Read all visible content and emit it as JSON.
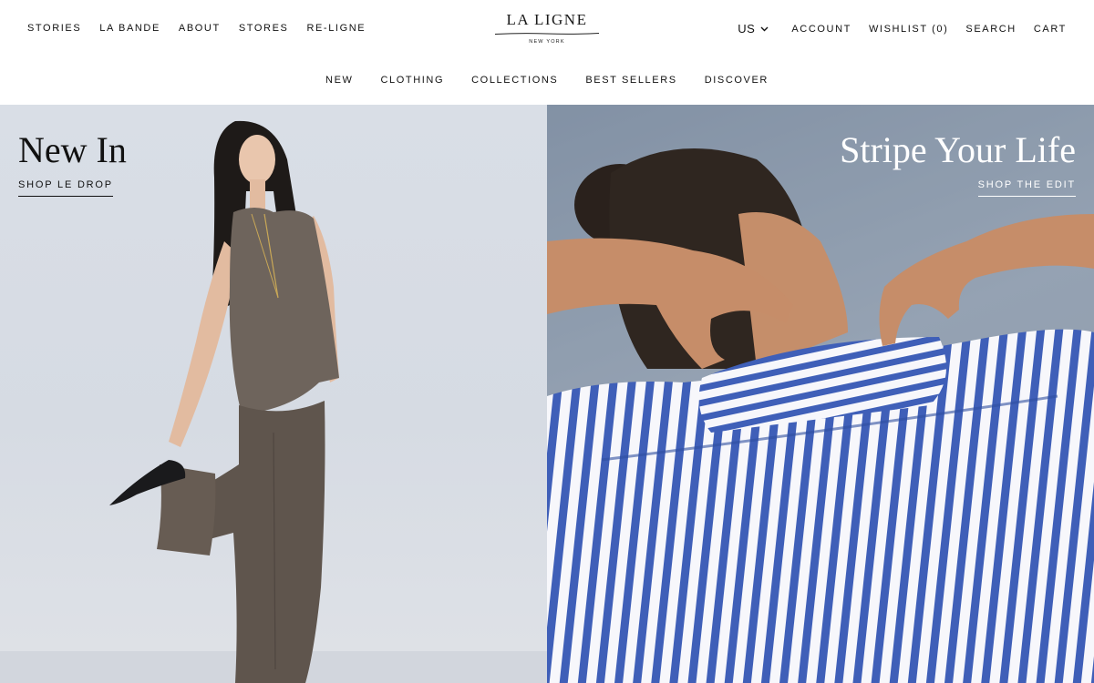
{
  "header": {
    "nav_left": [
      "STORIES",
      "LA BANDE",
      "ABOUT",
      "STORES",
      "RE-LIGNE"
    ],
    "logo": {
      "name": "LA LIGNE",
      "subtitle": "NEW YORK"
    },
    "locale": "US",
    "nav_right": {
      "account": "ACCOUNT",
      "wishlist": "WISHLIST (0)",
      "search": "SEARCH",
      "cart": "CART"
    },
    "nav_center": [
      "NEW",
      "CLOTHING",
      "COLLECTIONS",
      "BEST SELLERS",
      "DISCOVER"
    ]
  },
  "heroes": [
    {
      "title": "New In",
      "cta": "SHOP LE DROP",
      "image": "model-in-brown-satin-top-and-trousers"
    },
    {
      "title": "Stripe Your Life",
      "cta": "SHOP THE EDIT",
      "image": "model-in-blue-striped-shirt"
    }
  ],
  "colors": {
    "text": "#111111",
    "background": "#ffffff",
    "stripe_blue": "#3f5fb8",
    "left_bg": "#d9dee6"
  }
}
